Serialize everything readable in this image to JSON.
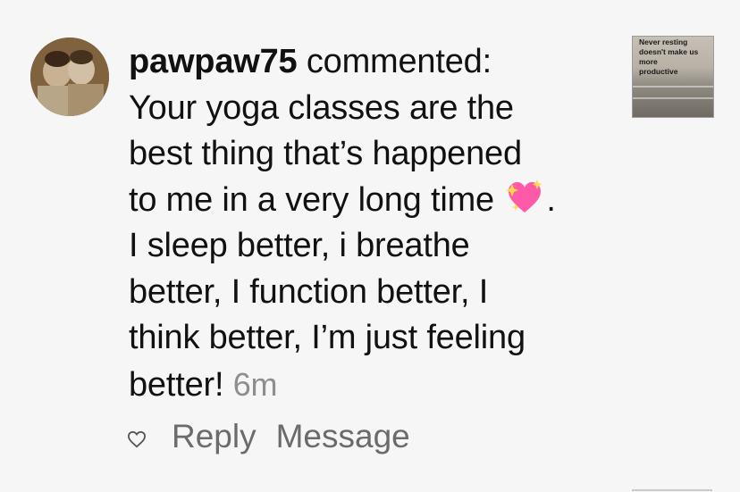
{
  "comment": {
    "username": "pawpaw75",
    "verb": " commented:",
    "lines": [
      "Your yoga classes are the",
      "best thing that’s happened",
      "to me in a very long time",
      "I sleep better, i breathe",
      "better, I function better, I",
      "think better, I’m just feeling",
      "better!"
    ],
    "emoji_suffix": ".",
    "timestamp": "6m"
  },
  "actions": {
    "reply": "Reply",
    "message": "Message"
  },
  "thumbnail": {
    "line1": "Never resting",
    "line2": "doesn't make us",
    "line3": "more",
    "line4": "productive"
  },
  "colors": {
    "background": "#f6f6f6",
    "text": "#111111",
    "muted": "#8e8e8e",
    "emoji_pink": "#ff4fa3"
  },
  "icons": {
    "heart": "heart-outline-icon",
    "sparkling_heart": "sparkling-heart-icon"
  }
}
